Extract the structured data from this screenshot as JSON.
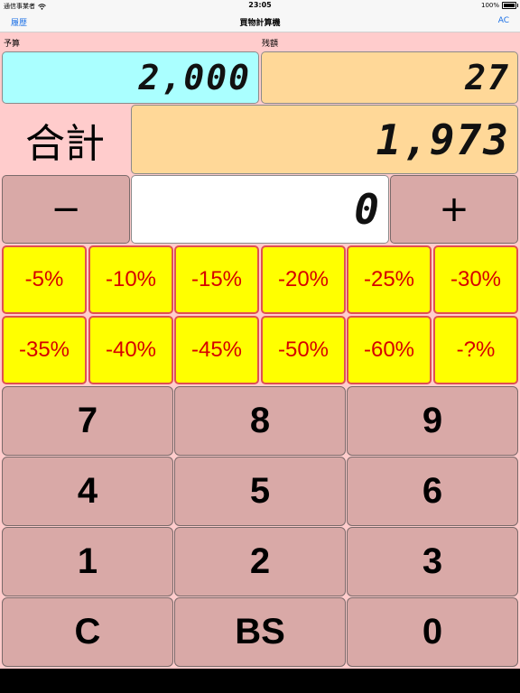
{
  "status_bar": {
    "carrier": "通信事業者",
    "time": "23:05",
    "battery_text": "100%"
  },
  "nav": {
    "left_label": "履歴",
    "title": "買物計算機",
    "right_label": "AC"
  },
  "labels": {
    "budget": "予算",
    "remaining": "残額",
    "total": "合計"
  },
  "displays": {
    "budget": "2,000",
    "remaining": "27",
    "total": "1,973",
    "input": "0"
  },
  "buttons": {
    "minus": "−",
    "plus": "+"
  },
  "percent_buttons": [
    "-5%",
    "-10%",
    "-15%",
    "-20%",
    "-25%",
    "-30%",
    "-35%",
    "-40%",
    "-45%",
    "-50%",
    "-60%",
    "-?%"
  ],
  "keypad": [
    "7",
    "8",
    "9",
    "4",
    "5",
    "6",
    "1",
    "2",
    "3",
    "C",
    "BS",
    "0"
  ],
  "colors": {
    "pink_bg": "#ffcccc",
    "cyan_display": "#aaffff",
    "tan_display": "#ffd898",
    "percent_bg": "#ffff00",
    "percent_text": "#d60000",
    "key_bg": "#d9a9a7",
    "nav_link": "#1a6fe6"
  }
}
